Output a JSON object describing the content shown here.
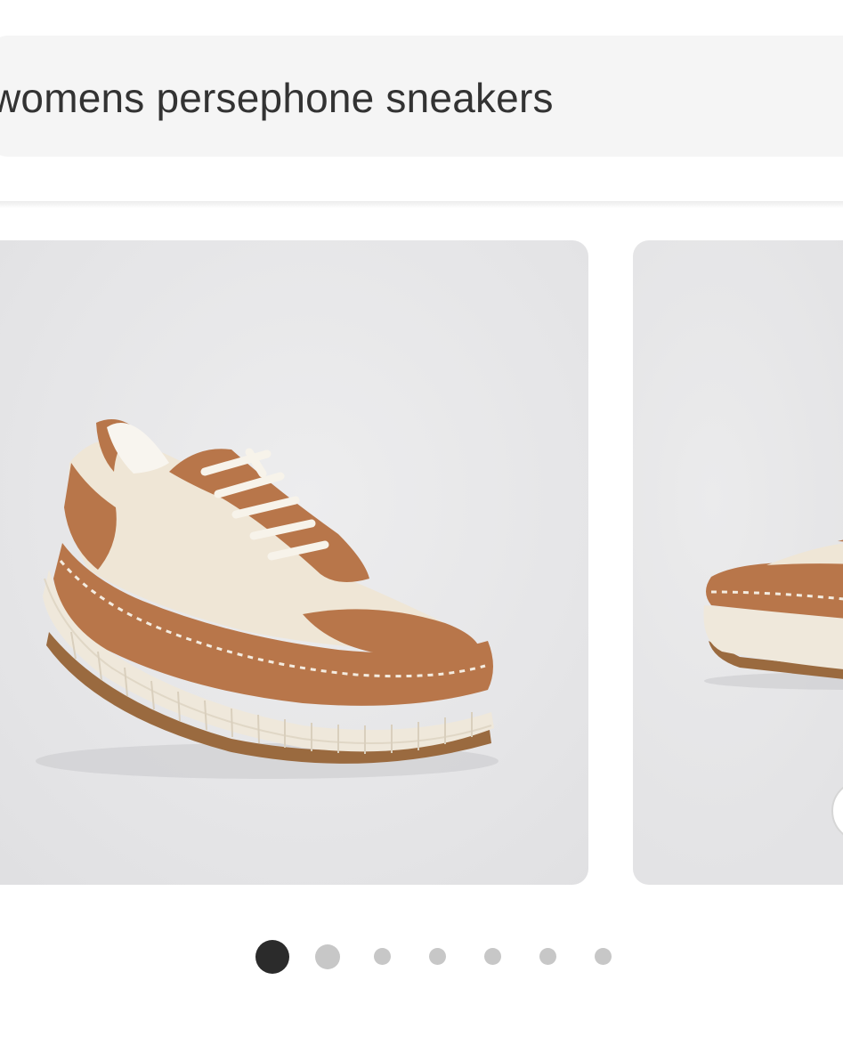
{
  "search": {
    "query": "womens persephone sneakers"
  },
  "carousel": {
    "images": [
      {
        "alt": "product-image-1"
      },
      {
        "alt": "product-image-2"
      }
    ],
    "active_index": 0,
    "total": 7
  },
  "colors": {
    "active_dot": "#2b2b2b",
    "inactive_dot": "#c7c7c7",
    "card_bg": "#e6e6e8",
    "suede": "#b8764a",
    "canvas": "#efe6d6"
  }
}
